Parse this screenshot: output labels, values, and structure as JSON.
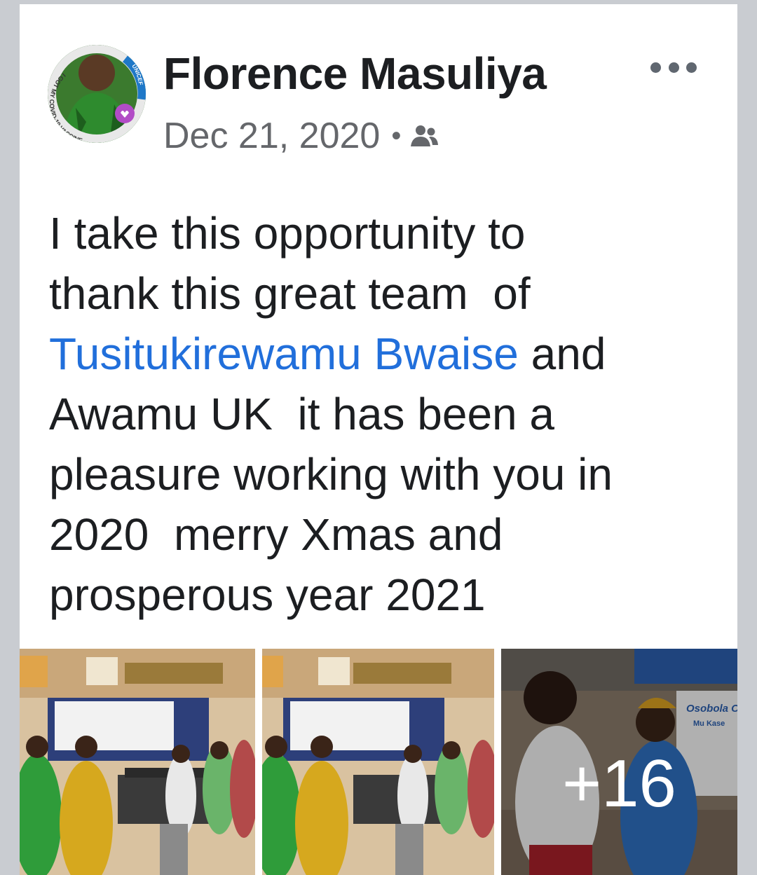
{
  "post": {
    "author": "Florence Masuliya",
    "date": "Dec 21, 2020",
    "separator": "•",
    "audience_icon": "friends-icon",
    "menu_icon": "more-horizontal-icon",
    "avatar_frame": {
      "left_text": "I GOT MY COVID-19 VACCINE",
      "right_text": "UNICEF"
    },
    "text_lines": [
      "I take this opportunity to",
      "thank this great team  of",
      {
        "link": "Tusitukirewamu Bwaise",
        "rest": " and"
      },
      "Awamu UK  it has been a",
      "pleasure working with you in",
      "2020  merry Xmas and",
      "prosperous year 2021"
    ],
    "photos": {
      "count_photos_shown": 3,
      "more_count": "+16",
      "sign_text": [
        "Osobola Ok",
        "Mu Kase"
      ]
    }
  },
  "colors": {
    "link": "#216fdb",
    "text": "#1c1e21",
    "meta": "#65676b",
    "background": "#c9ccd1"
  }
}
